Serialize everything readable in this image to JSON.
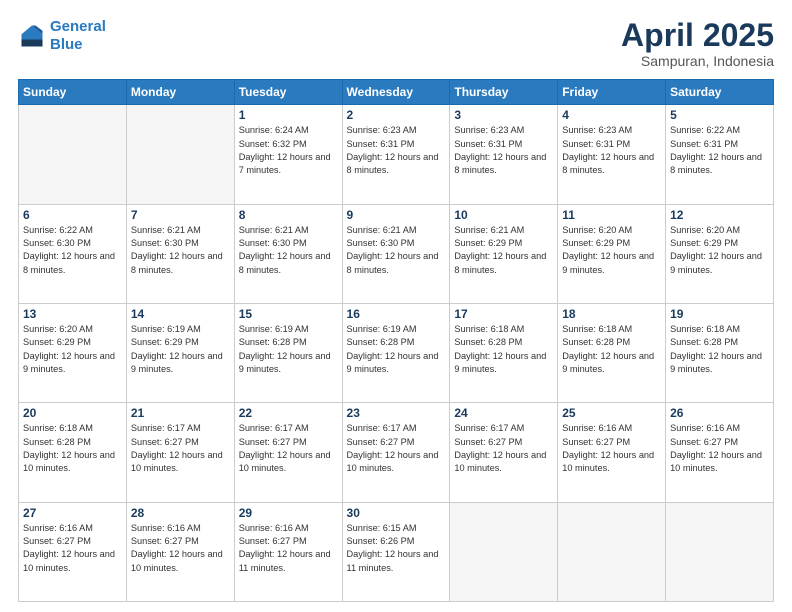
{
  "header": {
    "logo_line1": "General",
    "logo_line2": "Blue",
    "month_year": "April 2025",
    "location": "Sampuran, Indonesia"
  },
  "days_of_week": [
    "Sunday",
    "Monday",
    "Tuesday",
    "Wednesday",
    "Thursday",
    "Friday",
    "Saturday"
  ],
  "weeks": [
    [
      {
        "day": "",
        "info": ""
      },
      {
        "day": "",
        "info": ""
      },
      {
        "day": "1",
        "info": "Sunrise: 6:24 AM\nSunset: 6:32 PM\nDaylight: 12 hours and 7 minutes."
      },
      {
        "day": "2",
        "info": "Sunrise: 6:23 AM\nSunset: 6:31 PM\nDaylight: 12 hours and 8 minutes."
      },
      {
        "day": "3",
        "info": "Sunrise: 6:23 AM\nSunset: 6:31 PM\nDaylight: 12 hours and 8 minutes."
      },
      {
        "day": "4",
        "info": "Sunrise: 6:23 AM\nSunset: 6:31 PM\nDaylight: 12 hours and 8 minutes."
      },
      {
        "day": "5",
        "info": "Sunrise: 6:22 AM\nSunset: 6:31 PM\nDaylight: 12 hours and 8 minutes."
      }
    ],
    [
      {
        "day": "6",
        "info": "Sunrise: 6:22 AM\nSunset: 6:30 PM\nDaylight: 12 hours and 8 minutes."
      },
      {
        "day": "7",
        "info": "Sunrise: 6:21 AM\nSunset: 6:30 PM\nDaylight: 12 hours and 8 minutes."
      },
      {
        "day": "8",
        "info": "Sunrise: 6:21 AM\nSunset: 6:30 PM\nDaylight: 12 hours and 8 minutes."
      },
      {
        "day": "9",
        "info": "Sunrise: 6:21 AM\nSunset: 6:30 PM\nDaylight: 12 hours and 8 minutes."
      },
      {
        "day": "10",
        "info": "Sunrise: 6:21 AM\nSunset: 6:29 PM\nDaylight: 12 hours and 8 minutes."
      },
      {
        "day": "11",
        "info": "Sunrise: 6:20 AM\nSunset: 6:29 PM\nDaylight: 12 hours and 9 minutes."
      },
      {
        "day": "12",
        "info": "Sunrise: 6:20 AM\nSunset: 6:29 PM\nDaylight: 12 hours and 9 minutes."
      }
    ],
    [
      {
        "day": "13",
        "info": "Sunrise: 6:20 AM\nSunset: 6:29 PM\nDaylight: 12 hours and 9 minutes."
      },
      {
        "day": "14",
        "info": "Sunrise: 6:19 AM\nSunset: 6:29 PM\nDaylight: 12 hours and 9 minutes."
      },
      {
        "day": "15",
        "info": "Sunrise: 6:19 AM\nSunset: 6:28 PM\nDaylight: 12 hours and 9 minutes."
      },
      {
        "day": "16",
        "info": "Sunrise: 6:19 AM\nSunset: 6:28 PM\nDaylight: 12 hours and 9 minutes."
      },
      {
        "day": "17",
        "info": "Sunrise: 6:18 AM\nSunset: 6:28 PM\nDaylight: 12 hours and 9 minutes."
      },
      {
        "day": "18",
        "info": "Sunrise: 6:18 AM\nSunset: 6:28 PM\nDaylight: 12 hours and 9 minutes."
      },
      {
        "day": "19",
        "info": "Sunrise: 6:18 AM\nSunset: 6:28 PM\nDaylight: 12 hours and 9 minutes."
      }
    ],
    [
      {
        "day": "20",
        "info": "Sunrise: 6:18 AM\nSunset: 6:28 PM\nDaylight: 12 hours and 10 minutes."
      },
      {
        "day": "21",
        "info": "Sunrise: 6:17 AM\nSunset: 6:27 PM\nDaylight: 12 hours and 10 minutes."
      },
      {
        "day": "22",
        "info": "Sunrise: 6:17 AM\nSunset: 6:27 PM\nDaylight: 12 hours and 10 minutes."
      },
      {
        "day": "23",
        "info": "Sunrise: 6:17 AM\nSunset: 6:27 PM\nDaylight: 12 hours and 10 minutes."
      },
      {
        "day": "24",
        "info": "Sunrise: 6:17 AM\nSunset: 6:27 PM\nDaylight: 12 hours and 10 minutes."
      },
      {
        "day": "25",
        "info": "Sunrise: 6:16 AM\nSunset: 6:27 PM\nDaylight: 12 hours and 10 minutes."
      },
      {
        "day": "26",
        "info": "Sunrise: 6:16 AM\nSunset: 6:27 PM\nDaylight: 12 hours and 10 minutes."
      }
    ],
    [
      {
        "day": "27",
        "info": "Sunrise: 6:16 AM\nSunset: 6:27 PM\nDaylight: 12 hours and 10 minutes."
      },
      {
        "day": "28",
        "info": "Sunrise: 6:16 AM\nSunset: 6:27 PM\nDaylight: 12 hours and 10 minutes."
      },
      {
        "day": "29",
        "info": "Sunrise: 6:16 AM\nSunset: 6:27 PM\nDaylight: 12 hours and 11 minutes."
      },
      {
        "day": "30",
        "info": "Sunrise: 6:15 AM\nSunset: 6:26 PM\nDaylight: 12 hours and 11 minutes."
      },
      {
        "day": "",
        "info": ""
      },
      {
        "day": "",
        "info": ""
      },
      {
        "day": "",
        "info": ""
      }
    ]
  ]
}
